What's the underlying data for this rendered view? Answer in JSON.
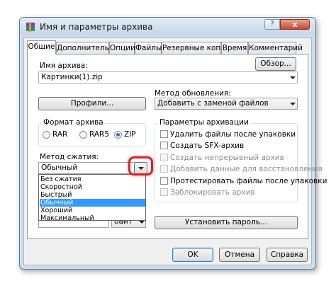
{
  "window": {
    "title": "Имя и параметры архива",
    "close_glyph": "x",
    "minimize_glyph": "?"
  },
  "tabs": [
    {
      "label": "Общие",
      "active": true
    },
    {
      "label": "Дополнительно"
    },
    {
      "label": "Опции"
    },
    {
      "label": "Файлы"
    },
    {
      "label": "Резервные копии"
    },
    {
      "label": "Время"
    },
    {
      "label": "Комментарий"
    }
  ],
  "archive_name": {
    "label": "Имя архива:",
    "value": "Картинки(1).zip",
    "browse_button": "Обзор..."
  },
  "profiles_button": "Профили...",
  "update_method": {
    "label": "Метод обновления:",
    "value": "Добавить с заменой файлов"
  },
  "archive_format": {
    "label": "Формат архива",
    "options": [
      {
        "label": "RAR"
      },
      {
        "label": "RAR5"
      },
      {
        "label": "ZIP",
        "selected": true
      }
    ]
  },
  "compression": {
    "label": "Метод сжатия:",
    "value": "Обычный",
    "options": [
      "Без сжатия",
      "Скоростной",
      "Быстрый",
      "Обычный",
      "Хороший",
      "Максимальный"
    ],
    "selected": "Обычный"
  },
  "split_unit": "байт",
  "archive_params": {
    "label": "Параметры архивации",
    "checkboxes": [
      {
        "label": "Удалить файлы после упаковки",
        "enabled": true
      },
      {
        "label": "Создать SFX-архив",
        "enabled": true
      },
      {
        "label": "Создать непрерывный архив",
        "enabled": false
      },
      {
        "label": "Добавить данные для восстановления",
        "enabled": false
      },
      {
        "label": "Протестировать файлы после упаковки",
        "enabled": true
      },
      {
        "label": "Заблокировать архив",
        "enabled": false
      }
    ]
  },
  "set_password_button": "Установить пароль...",
  "footer": {
    "ok": "OK",
    "cancel": "Отмена",
    "help": "Справка"
  },
  "colors": {
    "highlight": "#d8232a",
    "selection": "#3399ff"
  }
}
